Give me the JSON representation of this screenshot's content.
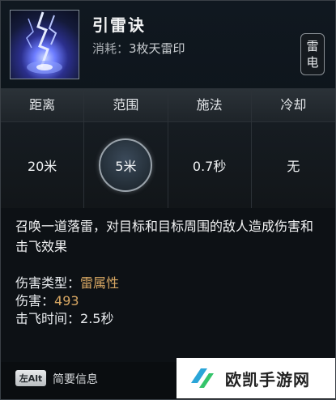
{
  "skill": {
    "name": "引雷诀",
    "cost_label": "消耗：",
    "cost_value": "3枚天雷印",
    "element_badge": [
      "雷",
      "电"
    ],
    "icon": "lightning-skill-icon"
  },
  "stats": [
    {
      "label": "距离",
      "value": "20米"
    },
    {
      "label": "范围",
      "value": "5米"
    },
    {
      "label": "施法",
      "value": "0.7秒"
    },
    {
      "label": "冷却",
      "value": "无"
    }
  ],
  "description": "召唤一道落雷，对目标和目标周围的敌人造成伤害和击飞效果",
  "attributes": [
    {
      "label": "伤害类型：",
      "value": "雷属性"
    },
    {
      "label": "伤害：",
      "value": "493"
    },
    {
      "label": "击飞时间：",
      "value": "2.5秒"
    }
  ],
  "footer": {
    "key_label": "左Alt",
    "text": "简要信息"
  },
  "watermark": {
    "text": "欧凯手游网"
  }
}
